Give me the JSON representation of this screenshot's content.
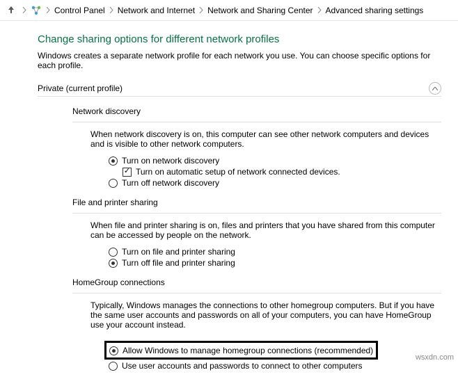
{
  "breadcrumb": {
    "items": [
      "Control Panel",
      "Network and Internet",
      "Network and Sharing Center",
      "Advanced sharing settings"
    ]
  },
  "title": "Change sharing options for different network profiles",
  "desc": "Windows creates a separate network profile for each network you use. You can choose specific options for each profile.",
  "profile": {
    "header": "Private (current profile)"
  },
  "netdisc": {
    "title": "Network discovery",
    "desc": "When network discovery is on, this computer can see other network computers and devices and is visible to other network computers.",
    "opt_on": "Turn on network discovery",
    "opt_auto": "Turn on automatic setup of network connected devices.",
    "opt_off": "Turn off network discovery"
  },
  "fps": {
    "title": "File and printer sharing",
    "desc": "When file and printer sharing is on, files and printers that you have shared from this computer can be accessed by people on the network.",
    "opt_on": "Turn on file and printer sharing",
    "opt_off": "Turn off file and printer sharing"
  },
  "hg": {
    "title": "HomeGroup connections",
    "desc": "Typically, Windows manages the connections to other homegroup computers. But if you have the same user accounts and passwords on all of your computers, you can have HomeGroup use your account instead.",
    "opt_allow": "Allow Windows to manage homegroup connections (recommended)",
    "opt_user": "Use user accounts and passwords to connect to other computers"
  },
  "watermark": "wsxdn.com"
}
